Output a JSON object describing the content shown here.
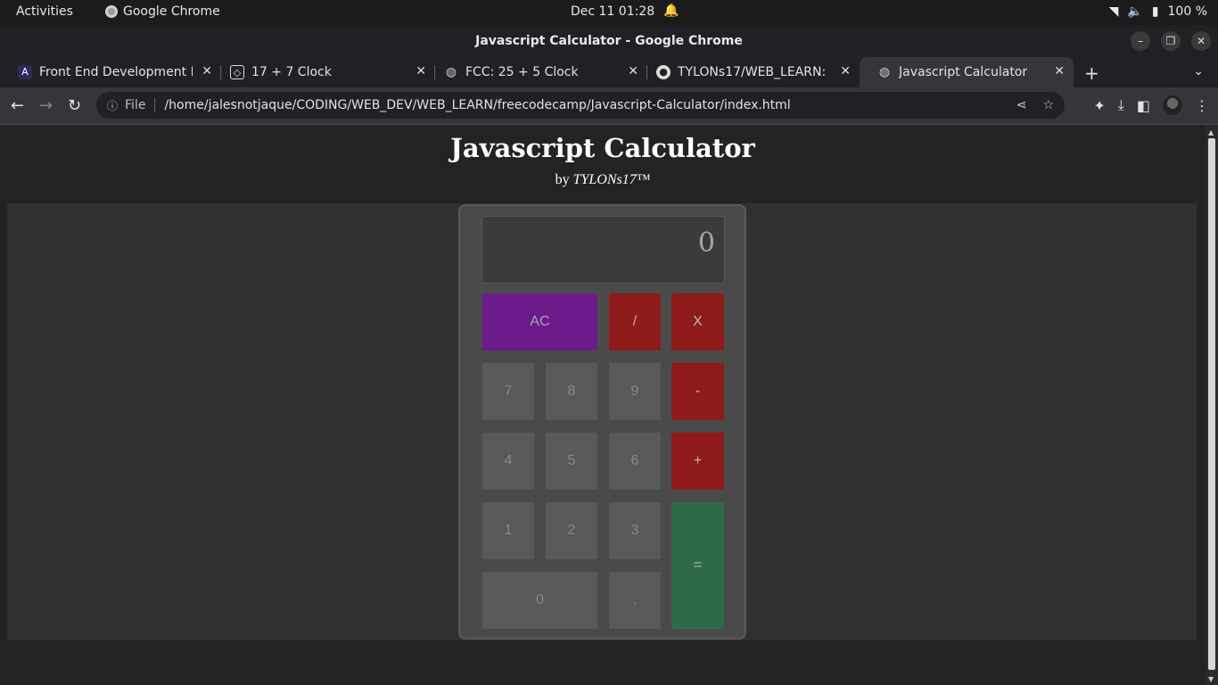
{
  "os": {
    "activities": "Activities",
    "app_name": "Google Chrome",
    "datetime": "Dec 11  01:28",
    "battery": "100 %"
  },
  "window": {
    "title": "Javascript Calculator - Google Chrome"
  },
  "tabs": [
    {
      "label": "Front End Development L",
      "favicon": "angular-icon"
    },
    {
      "label": "17 + 7 Clock",
      "favicon": "codepen-icon"
    },
    {
      "label": "FCC: 25 + 5 Clock",
      "favicon": "globe-icon"
    },
    {
      "label": "TYLONs17/WEB_LEARN:",
      "favicon": "github-icon"
    },
    {
      "label": "Javascript Calculator",
      "favicon": "globe-icon",
      "active": true
    }
  ],
  "omnibox": {
    "scheme_label": "File",
    "url": "/home/jalesnotjaque/CODING/WEB_DEV/WEB_LEARN/freecodecamp/Javascript-Calculator/index.html"
  },
  "page": {
    "title": "Javascript Calculator",
    "byline_prefix": "by",
    "byline_author": "TYLONs17™"
  },
  "calculator": {
    "display": "0",
    "keys": {
      "clear": "AC",
      "divide": "/",
      "multiply": "X",
      "subtract": "-",
      "add": "+",
      "equals": "=",
      "decimal": ".",
      "zero": "0",
      "one": "1",
      "two": "2",
      "three": "3",
      "four": "4",
      "five": "5",
      "six": "6",
      "seven": "7",
      "eight": "8",
      "nine": "9"
    }
  },
  "colors": {
    "clear_key": "#6b1b8a",
    "operator_key": "#8e1a1a",
    "equals_key": "#2d6b46",
    "number_key": "#595959"
  }
}
